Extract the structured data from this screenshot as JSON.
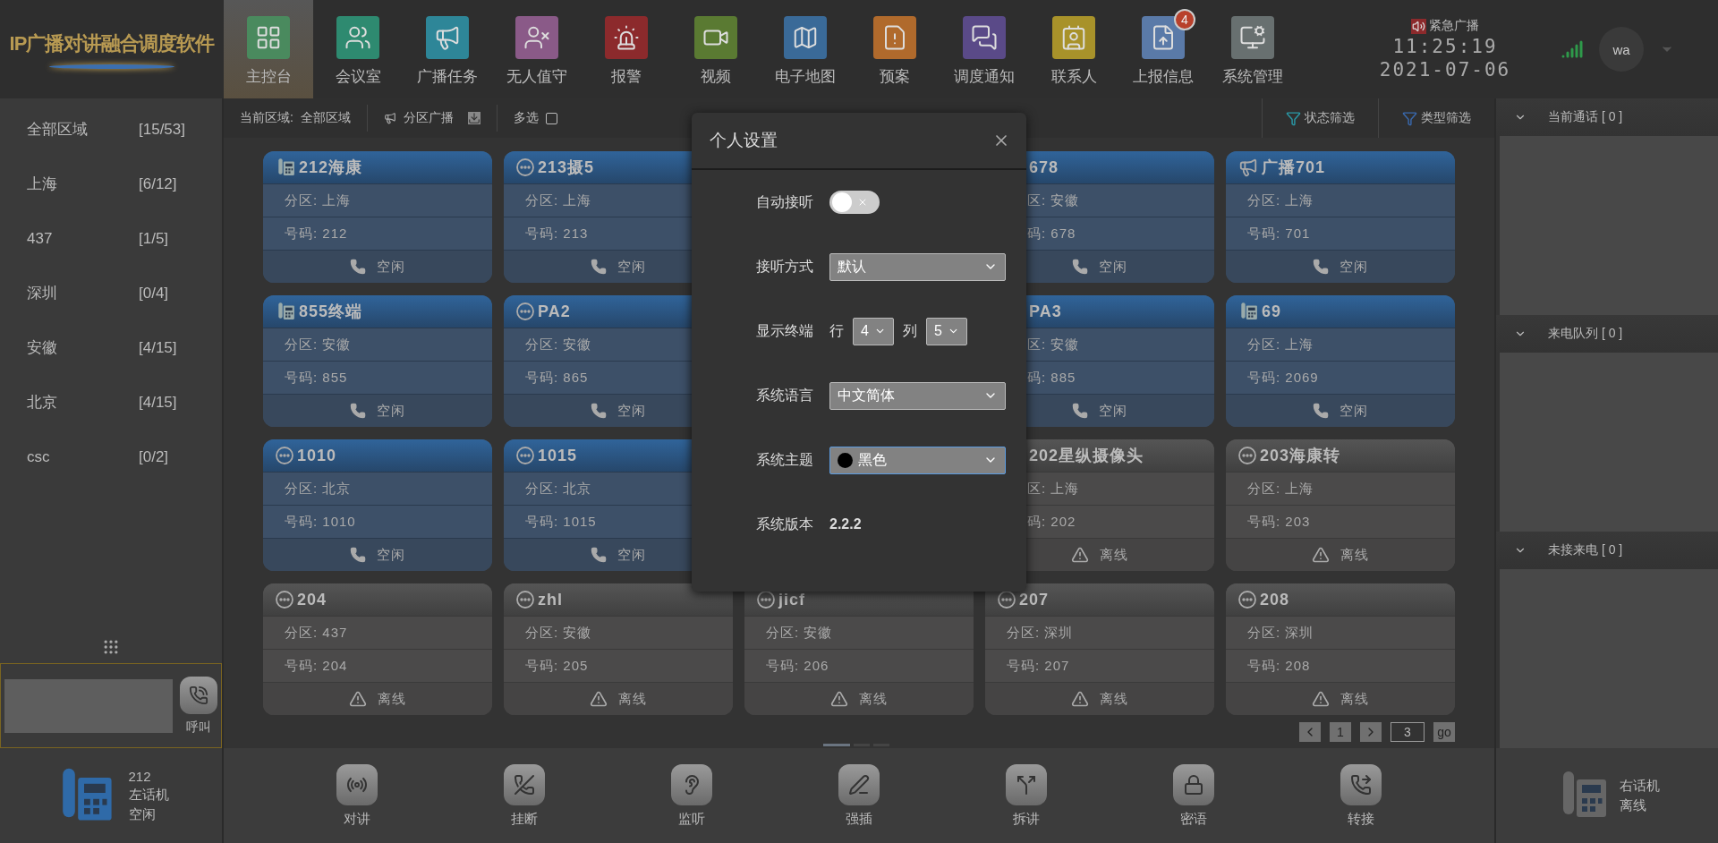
{
  "logo": "IP广播对讲融合调度软件",
  "nav": [
    {
      "label": "主控台",
      "selected": true,
      "color": "#4a8a5e"
    },
    {
      "label": "会议室",
      "selected": false,
      "color": "#2e8a70"
    },
    {
      "label": "广播任务",
      "selected": false,
      "color": "#2e8698"
    },
    {
      "label": "无人值守",
      "selected": false,
      "color": "#8a5a88"
    },
    {
      "label": "报警",
      "selected": false,
      "color": "#8c2a2c"
    },
    {
      "label": "视频",
      "selected": false,
      "color": "#5a7a32"
    },
    {
      "label": "电子地图",
      "selected": false,
      "color": "#3a6a98"
    },
    {
      "label": "预案",
      "selected": false,
      "color": "#b06a2c"
    },
    {
      "label": "调度通知",
      "selected": false,
      "color": "#5a4a88"
    },
    {
      "label": "联系人",
      "selected": false,
      "color": "#a8922a"
    },
    {
      "label": "上报信息",
      "selected": false,
      "color": "#5a7aa8",
      "badge": "4"
    },
    {
      "label": "系统管理",
      "selected": false,
      "color": "#687070"
    }
  ],
  "emergency": "紧急广播",
  "time": "11:25:19",
  "date": "2021-07-06",
  "user": "wa",
  "regions": [
    {
      "name": "全部区域",
      "count": "[15/53]"
    },
    {
      "name": "上海",
      "count": "[6/12]"
    },
    {
      "name": "437",
      "count": "[1/5]"
    },
    {
      "name": "深圳",
      "count": "[0/4]"
    },
    {
      "name": "安徽",
      "count": "[4/15]"
    },
    {
      "name": "北京",
      "count": "[4/15]"
    },
    {
      "name": "csc",
      "count": "[0/2]"
    }
  ],
  "call_button": "呼叫",
  "left_phone": {
    "number": "212",
    "name": "左话机",
    "status": "空闲",
    "online": true
  },
  "toolbar": {
    "area_label": "当前区域:",
    "area": "全部区域",
    "zone_broadcast": "分区广播",
    "multi_select": {
      "label": "多选",
      "checked": false
    },
    "filters": [
      "状态筛选",
      "类型筛选"
    ]
  },
  "cards": [
    {
      "kind": "desk-phone",
      "title": "212海康",
      "zone": "分区: 上海",
      "number": "号码: 212",
      "status": "空闲",
      "online": true
    },
    {
      "kind": "sip",
      "title": "213摄5",
      "zone": "分区: 上海",
      "number": "号码: 213",
      "status": "空闲",
      "online": true
    },
    {
      "kind": "covered"
    },
    {
      "kind": "cut-off",
      "title": "678",
      "zone": "区: 安徽",
      "number": "码: 678",
      "status": "空闲",
      "online": true
    },
    {
      "kind": "speaker",
      "title": "广播701",
      "zone": "分区: 上海",
      "number": "号码: 701",
      "status": "空闲",
      "online": true
    },
    {
      "kind": "desk-phone",
      "title": "855终端",
      "zone": "分区: 安徽",
      "number": "号码: 855",
      "status": "空闲",
      "online": true
    },
    {
      "kind": "sip",
      "title": "PA2",
      "zone": "分区: 安徽",
      "number": "号码: 865",
      "status": "空闲",
      "online": true
    },
    {
      "kind": "covered"
    },
    {
      "kind": "cut-off",
      "title": "PA3",
      "zone": "区: 安徽",
      "number": "码: 885",
      "status": "空闲",
      "online": true
    },
    {
      "kind": "desk-phone",
      "title": "69",
      "zone": "分区: 上海",
      "number": "号码: 2069",
      "status": "空闲",
      "online": true
    },
    {
      "kind": "sip",
      "title": "1010",
      "zone": "分区: 北京",
      "number": "号码: 1010",
      "status": "空闲",
      "online": true
    },
    {
      "kind": "sip",
      "title": "1015",
      "zone": "分区: 北京",
      "number": "号码: 1015",
      "status": "空闲",
      "online": true
    },
    {
      "kind": "covered"
    },
    {
      "kind": "cut-off",
      "title": "202星纵摄像头",
      "zone": "区: 上海",
      "number": "码: 202",
      "status": "离线",
      "online": false
    },
    {
      "kind": "sip",
      "title": "203海康转",
      "zone": "分区: 上海",
      "number": "号码: 203",
      "status": "离线",
      "online": false
    },
    {
      "kind": "sip",
      "title": "204",
      "zone": "分区: 437",
      "number": "号码: 204",
      "status": "离线",
      "online": false
    },
    {
      "kind": "sip",
      "title": "zhl",
      "zone": "分区: 安徽",
      "number": "号码: 205",
      "status": "离线",
      "online": false
    },
    {
      "kind": "sip",
      "title": "jicf",
      "zone": "分区: 安徽",
      "number": "号码: 206",
      "status": "离线",
      "online": false
    },
    {
      "kind": "sip",
      "title": "207",
      "zone": "分区: 深圳",
      "number": "号码: 207",
      "status": "离线",
      "online": false
    },
    {
      "kind": "sip",
      "title": "208",
      "zone": "分区: 深圳",
      "number": "号码: 208",
      "status": "离线",
      "online": false
    }
  ],
  "pagination": {
    "page": "1",
    "input": "3",
    "go": "go"
  },
  "actions": [
    "对讲",
    "挂断",
    "监听",
    "强插",
    "拆讲",
    "密语",
    "转接"
  ],
  "sections": [
    {
      "title": "当前通话 [ 0 ]",
      "expanded": true
    },
    {
      "title": "来电队列 [ 0 ]",
      "expanded": true
    },
    {
      "title": "未接来电 [ 0 ]",
      "expanded": true
    }
  ],
  "right_phone": {
    "name": "右话机",
    "status": "离线",
    "online": false
  },
  "modal": {
    "title": "个人设置",
    "fields": [
      {
        "kind": "toggle",
        "label": "自动接听",
        "on": false
      },
      {
        "kind": "select",
        "label": "接听方式",
        "value": "默认",
        "focused": false
      },
      {
        "kind": "grid",
        "label": "显示终端",
        "row_label": "行",
        "rows": "4",
        "col_label": "列",
        "cols": "5"
      },
      {
        "kind": "select",
        "label": "系统语言",
        "value": "中文简体",
        "focused": false
      },
      {
        "kind": "select",
        "label": "系统主题",
        "value": "黑色",
        "focused": true,
        "color": "#000000"
      },
      {
        "kind": "text",
        "label": "系统版本",
        "value": "2.2.2"
      }
    ]
  }
}
